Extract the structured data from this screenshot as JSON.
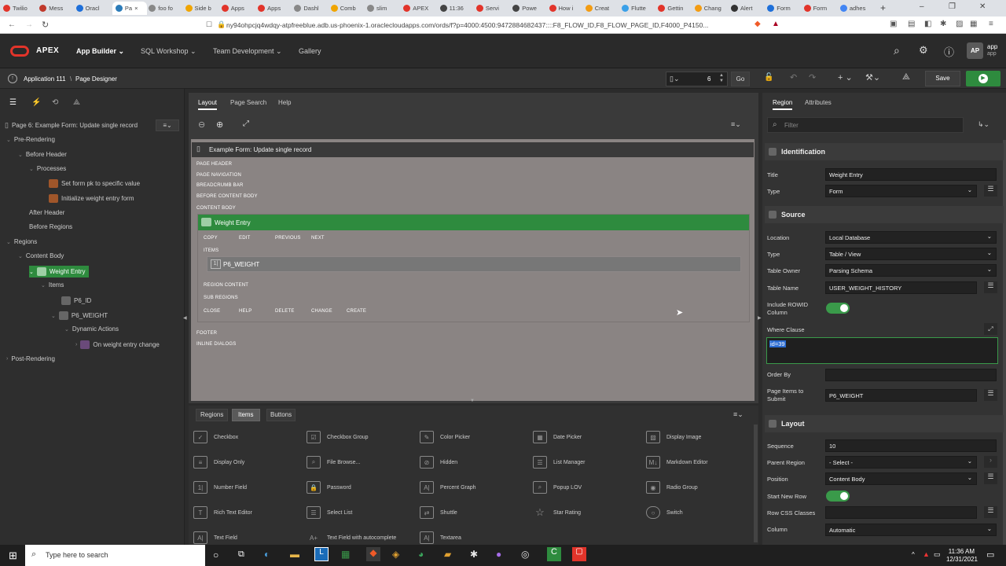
{
  "browser": {
    "tabs": [
      "Twilio",
      "Mess",
      "Oracl",
      "Pa",
      "foo fo",
      "Side b",
      "Apps",
      "Apps",
      "Dashl",
      "Comb",
      "slim",
      "APEX",
      "11:36",
      "Servi",
      "Powe",
      "How i",
      "Creat",
      "Flutte",
      "Gettin",
      "Chang",
      "Alert",
      "Form",
      "Form",
      "adhes"
    ],
    "url": "ny94ohpcjq4wdqy-atpfreeblue.adb.us-phoenix-1.oraclecloudapps.com/ords/f?p=4000:4500:9472884682437::::F8_FLOW_ID,F8_FLOW_PAGE_ID,F4000_P4150..."
  },
  "header": {
    "brand": "APEX",
    "nav": [
      "App Builder",
      "SQL Workshop",
      "Team Development",
      "Gallery"
    ],
    "user_initials": "AP",
    "user_label_1": "app",
    "user_label_2": "app"
  },
  "pd_toolbar": {
    "breadcrumb_app": "Application 111",
    "breadcrumb_page": "Page Designer",
    "page_number": "6",
    "go_label": "Go",
    "save_label": "Save"
  },
  "left": {
    "page_title": "Page 6: Example Form: Update single record",
    "tree": [
      "Pre-Rendering",
      "Before Header",
      "Processes",
      "Set form pk to specific value",
      "Initialize weight entry form",
      "After Header",
      "Before Regions",
      "Regions",
      "Content Body",
      "Weight Entry",
      "Items",
      "P6_ID",
      "P6_WEIGHT",
      "Dynamic Actions",
      "On weight entry change",
      "Post-Rendering"
    ]
  },
  "center": {
    "tabs": [
      "Layout",
      "Page Search",
      "Help"
    ],
    "page_title": "Example Form: Update single record",
    "positions": [
      "PAGE HEADER",
      "PAGE NAVIGATION",
      "BREADCRUMB BAR",
      "BEFORE CONTENT BODY",
      "CONTENT BODY"
    ],
    "region_title": "Weight Entry",
    "top_buttons": [
      "COPY",
      "EDIT",
      "PREVIOUS",
      "NEXT"
    ],
    "items_label": "ITEMS",
    "item": "P6_WEIGHT",
    "region_content": "REGION CONTENT",
    "sub_regions": "SUB REGIONS",
    "bottom_buttons": [
      "CLOSE",
      "HELP",
      "DELETE",
      "CHANGE",
      "CREATE"
    ],
    "footer": "FOOTER",
    "inline_dialogs": "INLINE DIALOGS"
  },
  "gallery": {
    "tabs": [
      "Regions",
      "Items",
      "Buttons"
    ],
    "items": [
      "Checkbox",
      "Checkbox Group",
      "Color Picker",
      "Date Picker",
      "Display Image",
      "Display Only",
      "File Browse...",
      "Hidden",
      "List Manager",
      "Markdown Editor",
      "Number Field",
      "Password",
      "Percent Graph",
      "Popup LOV",
      "Radio Group",
      "Rich Text Editor",
      "Select List",
      "Shuttle",
      "Star Rating",
      "Switch",
      "Text Field",
      "Text Field with autocomplete",
      "Textarea"
    ]
  },
  "right": {
    "tabs": [
      "Region",
      "Attributes"
    ],
    "filter_placeholder": "Filter",
    "sections": {
      "identification": "Identification",
      "source": "Source",
      "layout": "Layout"
    },
    "labels": {
      "title": "Title",
      "type": "Type",
      "location": "Location",
      "source_type": "Type",
      "table_owner": "Table Owner",
      "table_name": "Table Name",
      "include_rowid": "Include ROWID Column",
      "where_clause": "Where Clause",
      "order_by": "Order By",
      "page_items": "Page Items to Submit",
      "sequence": "Sequence",
      "parent_region": "Parent Region",
      "position": "Position",
      "start_new_row": "Start New Row",
      "row_css": "Row CSS Classes",
      "column": "Column"
    },
    "values": {
      "title": "Weight Entry",
      "type": "Form",
      "location": "Local Database",
      "source_type": "Table / View",
      "table_owner": "Parsing Schema",
      "table_name": "USER_WEIGHT_HISTORY",
      "where_clause": "id=39",
      "order_by": "",
      "page_items": "P6_WEIGHT",
      "sequence": "10",
      "parent_region": "- Select -",
      "position": "Content Body",
      "row_css": "",
      "column": "Automatic"
    }
  },
  "taskbar": {
    "search_placeholder": "Type here to search",
    "time": "11:36 AM",
    "date": "12/31/2021"
  }
}
